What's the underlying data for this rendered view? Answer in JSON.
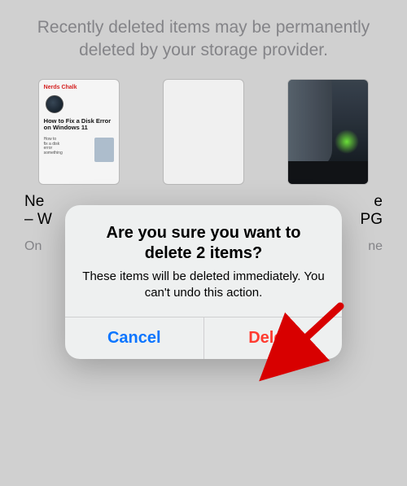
{
  "header": {
    "text": "Recently deleted items may be permanently deleted by your storage provider."
  },
  "items": [
    {
      "name_line1": "Ne",
      "name_line2": "– W",
      "location": "On"
    },
    {
      "name_line1": "",
      "name_line2": "",
      "location": ""
    },
    {
      "name_line1": "e",
      "name_line2": "PG",
      "location": "ne"
    }
  ],
  "alert": {
    "title": "Are you sure you want to delete 2 items?",
    "message": "These items will be deleted immediately. You can't undo this action.",
    "cancel_label": "Cancel",
    "delete_label": "Delete"
  },
  "annotation": {
    "type": "arrow",
    "color": "#d80000",
    "target": "delete-button"
  }
}
